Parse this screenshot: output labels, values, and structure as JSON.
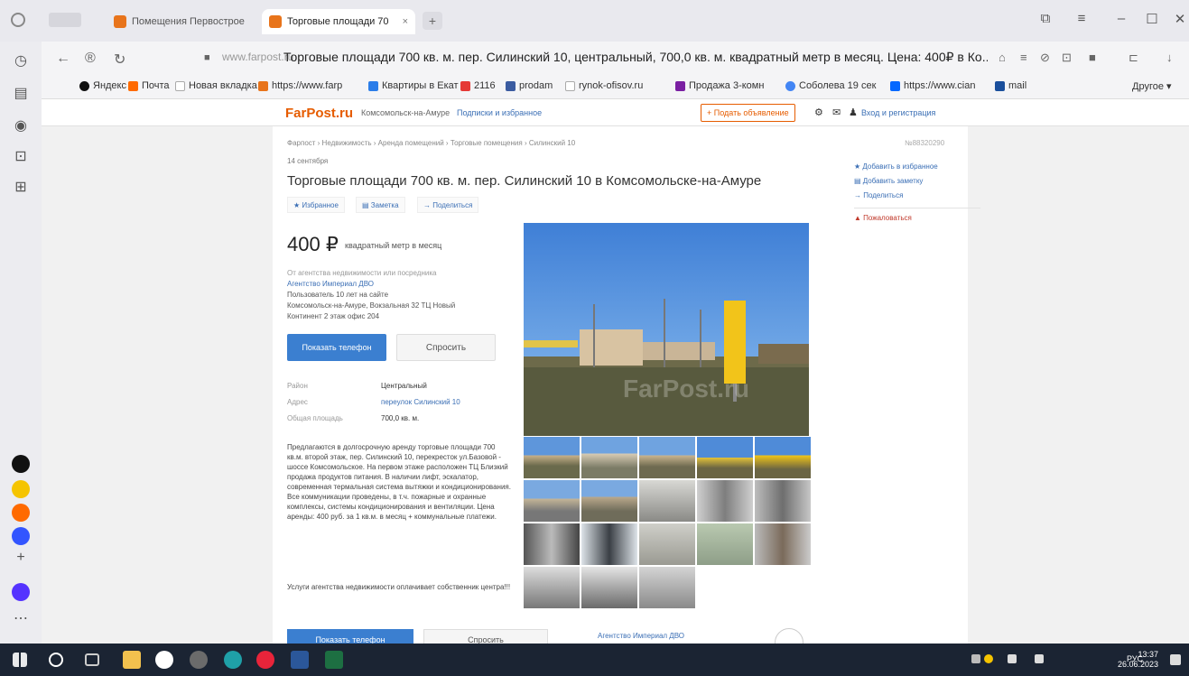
{
  "browser": {
    "tabs": [
      {
        "label": "Помещения Первострое"
      },
      {
        "label": "Торговые площади 70"
      }
    ],
    "tab_close": "×",
    "new_tab": "+",
    "window_controls": {
      "minimize": "–",
      "maximize": "☐",
      "close": "✕"
    },
    "address": {
      "host": "www.farpost.ru",
      "title": "Торговые площади 700 кв. м. пер. Силинский 10, центральный, 700,0 кв. м. квадратный метр в месяц. Цена: 400₽ в Ко..."
    },
    "bookmarks": [
      {
        "label": "Яндекс",
        "color": "#111111"
      },
      {
        "label": "Почта",
        "color": "#ff6a00"
      },
      {
        "label": "Новая вкладка",
        "color": "#cfcfcf"
      },
      {
        "label": "https://www.farp",
        "color": "#e8741b"
      },
      {
        "label": "Квартиры в Екат",
        "color": "#2b7de9"
      },
      {
        "label": "2116",
        "color": "#e53935"
      },
      {
        "label": "prodam",
        "color": "#3a5ba0"
      },
      {
        "label": "rynok-ofisov.ru",
        "color": "#cfcfcf"
      },
      {
        "label": "Продажа 3-комн",
        "color": "#7a1fa2"
      },
      {
        "label": "Соболева 19 сек",
        "color": "#4285f4"
      },
      {
        "label": "https://www.cian",
        "color": "#0468ff"
      },
      {
        "label": "mail",
        "color": "#1a4f9c"
      }
    ],
    "bookmarks_other": "Другое ▾"
  },
  "site": {
    "logo": "FarPost.ru",
    "city": "Комсомольск-на-Амуре",
    "subscriptions": "Подписки и избранное",
    "submit_ad": "+ Подать объявление",
    "login": "Вход и регистрация"
  },
  "listing": {
    "breadcrumbs": "Фарпост › Недвижимость › Аренда помещений › Торговые помещения › Силинский 10",
    "ad_number": "№88320290",
    "date": "14 сентября",
    "title": "Торговые площади 700 кв. м. пер. Силинский 10 в Комсомольске-на-Амуре",
    "actions": [
      "Избранное",
      "Заметка",
      "Поделиться"
    ],
    "price": "400 ₽",
    "price_unit": "квадратный метр в месяц",
    "seller_note": "От агентства недвижимости или посредника",
    "agency": "Агентство Империал ДВО",
    "member_since": "Пользователь 10 лет на сайте",
    "address_line": "Комсомольск-на-Амуре, Вокзальная 32 ТЦ Новый",
    "address_line2": "Континент 2 этаж офис 204",
    "show_phone": "Показать телефон",
    "ask": "Спросить",
    "props": [
      {
        "key": "Район",
        "value": "Центральный"
      },
      {
        "key": "Адрес",
        "value": "переулок Силинский 10"
      },
      {
        "key": "Общая площадь",
        "value": "700,0 кв. м."
      }
    ],
    "description": "Предлагаются в долгосрочную аренду торговые площади 700 кв.м. второй этаж, пер. Силинский 10, перекресток ул.Базовой - шоссе Комсомольское. На первом этаже расположен ТЦ Близкий продажа продуктов питания. В наличии лифт, эскалатор, современная термальная система вытяжки и кондиционирования. Все коммуникации проведены, в т.ч. пожарные и охранные комплексы, системы кондиционирования и вентиляции. Цена аренды: 400 руб. за 1 кв.м. в месяц + коммунальные платежи.",
    "description2": "Услуги агентства недвижимости оплачивает собственник центра!!!",
    "photo_watermark": "FarPost.ru",
    "side_links": [
      {
        "label": "Добавить в избранное"
      },
      {
        "label": "Добавить заметку"
      },
      {
        "label": "Поделиться"
      },
      {
        "label": "Пожаловаться"
      }
    ],
    "bottom_show_phone": "Показать телефон",
    "bottom_ask": "Спросить",
    "bottom_agency": "Агентство Империал ДВО"
  },
  "taskbar": {
    "lang": "РУС",
    "time": "13:37",
    "date": "26.06.2023"
  }
}
